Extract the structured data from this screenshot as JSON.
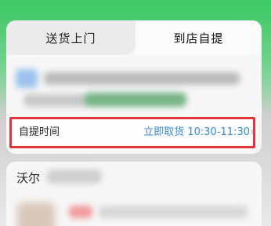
{
  "tabs": {
    "delivery_label": "送货上门",
    "pickup_label": "到店自提"
  },
  "pickup": {
    "label": "自提时间",
    "value": "立即取货 10:30-11:30",
    "chevron": "›"
  },
  "store": {
    "name_visible": "沃尔"
  },
  "colors": {
    "highlight_border": "#e0363e",
    "link_blue": "#3a8bd6",
    "header_green": "#3fc76a"
  }
}
